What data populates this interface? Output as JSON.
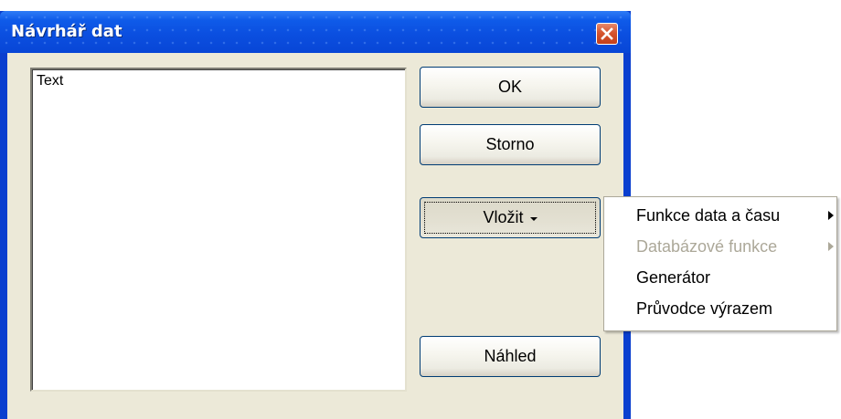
{
  "window": {
    "title": "Návrhář dat",
    "close_icon": "close-icon"
  },
  "editor": {
    "text": "Text"
  },
  "buttons": {
    "ok": "OK",
    "cancel": "Storno",
    "insert": "Vložit",
    "preview": "Náhled"
  },
  "insert_menu": {
    "items": [
      {
        "label": "Funkce data a času",
        "enabled": true,
        "has_submenu": true
      },
      {
        "label": "Databázové funkce",
        "enabled": false,
        "has_submenu": true
      },
      {
        "label": "Generátor",
        "enabled": true,
        "has_submenu": false
      },
      {
        "label": "Průvodce výrazem",
        "enabled": true,
        "has_submenu": false
      }
    ]
  },
  "colors": {
    "titlebar": "#0c55e4",
    "dialog_face": "#ece9d8",
    "button_border": "#003c74",
    "close_button": "#d6552f",
    "disabled_text": "#aca899"
  }
}
